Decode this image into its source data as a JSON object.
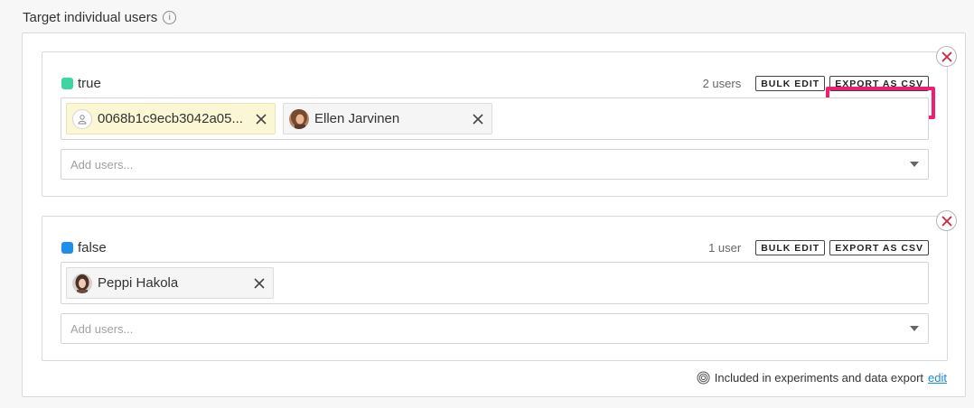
{
  "section": {
    "title": "Target individual users",
    "info_icon": "info-icon"
  },
  "variations": [
    {
      "label": "true",
      "color": "#3dd6a0",
      "user_count": "2 users",
      "bulk_edit_label": "BULK EDIT",
      "export_label": "EXPORT AS CSV",
      "users": [
        {
          "name": "0068b1c9ecb3042a05...",
          "avatar": "generic-user-icon",
          "style": "yellow"
        },
        {
          "name": "Ellen Jarvinen",
          "avatar": "avatar-photo",
          "style": "gray"
        }
      ],
      "add_placeholder": "Add users..."
    },
    {
      "label": "false",
      "color": "#1f8ee8",
      "user_count": "1 user",
      "bulk_edit_label": "BULK EDIT",
      "export_label": "EXPORT AS CSV",
      "users": [
        {
          "name": "Peppi Hakola",
          "avatar": "avatar-photo",
          "style": "gray"
        }
      ],
      "add_placeholder": "Add users..."
    }
  ],
  "footer": {
    "text": "Included in experiments and data export",
    "link": "edit",
    "icon": "target-icon"
  },
  "colors": {
    "highlight": "#f01d70",
    "remove_x": "#d0243a",
    "link": "#1a8ad6"
  }
}
